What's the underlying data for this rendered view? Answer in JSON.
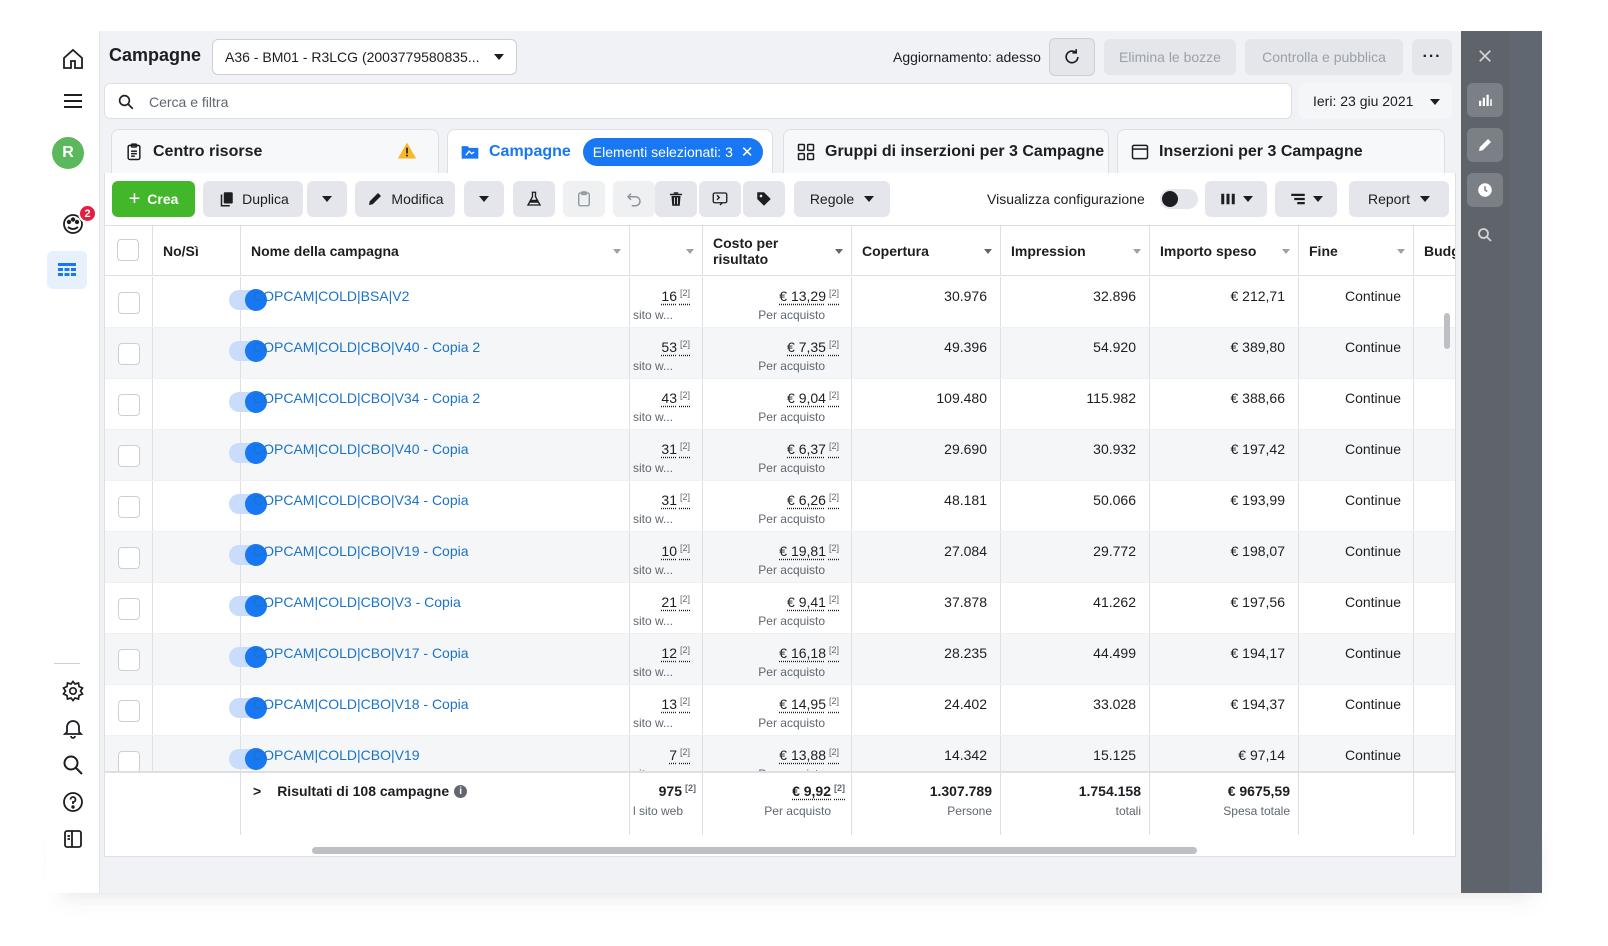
{
  "page": {
    "title": "Campagne"
  },
  "account": {
    "label": "A36 - BM01 - R3LCG (2003779580835..."
  },
  "header": {
    "update_status": "Aggiornamento: adesso",
    "discard_label": "Elimina le bozze",
    "publish_label": "Controlla e pubblica",
    "more_label": "···"
  },
  "search": {
    "placeholder": "Cerca e filtra"
  },
  "date_range": {
    "label": "Ieri: 23 giu 2021"
  },
  "rail": {
    "avatar_initial": "R",
    "notification_count": "2"
  },
  "tabs": {
    "resource_center": "Centro risorse",
    "campaigns": "Campagne",
    "selected_pill": "Elementi selezionati: 3",
    "adsets": "Gruppi di inserzioni per 3 Campagne",
    "ads": "Inserzioni per 3 Campagne"
  },
  "toolbar": {
    "create": "Crea",
    "duplicate": "Duplica",
    "edit": "Modifica",
    "rules": "Regole",
    "view_setup": "Visualizza configurazione",
    "report": "Report"
  },
  "table": {
    "headers": {
      "toggle": "No/Sì",
      "name": "Nome della campagna",
      "cost": "Costo per risultato",
      "reach": "Copertura",
      "impressions": "Impression",
      "spent": "Importo speso",
      "end": "Fine",
      "budget": "Budg"
    },
    "result_sub": "sito w...",
    "cost_sub": "Per acquisto",
    "sup": "[2]",
    "rows": [
      {
        "name": "COPCAM|COLD|BSA|V2",
        "results": "16",
        "cost": "€ 13,29",
        "reach": "30.976",
        "impressions": "32.896",
        "spent": "€ 212,71",
        "end": "Continue"
      },
      {
        "name": "COPCAM|COLD|CBO|V40 - Copia 2",
        "results": "53",
        "cost": "€ 7,35",
        "reach": "49.396",
        "impressions": "54.920",
        "spent": "€ 389,80",
        "end": "Continue"
      },
      {
        "name": "COPCAM|COLD|CBO|V34 - Copia 2",
        "results": "43",
        "cost": "€ 9,04",
        "reach": "109.480",
        "impressions": "115.982",
        "spent": "€ 388,66",
        "end": "Continue"
      },
      {
        "name": "COPCAM|COLD|CBO|V40 - Copia",
        "results": "31",
        "cost": "€ 6,37",
        "reach": "29.690",
        "impressions": "30.932",
        "spent": "€ 197,42",
        "end": "Continue"
      },
      {
        "name": "COPCAM|COLD|CBO|V34 - Copia",
        "results": "31",
        "cost": "€ 6,26",
        "reach": "48.181",
        "impressions": "50.066",
        "spent": "€ 193,99",
        "end": "Continue"
      },
      {
        "name": "COPCAM|COLD|CBO|V19 - Copia",
        "results": "10",
        "cost": "€ 19,81",
        "reach": "27.084",
        "impressions": "29.772",
        "spent": "€ 198,07",
        "end": "Continue"
      },
      {
        "name": "COPCAM|COLD|CBO|V3 - Copia",
        "results": "21",
        "cost": "€ 9,41",
        "reach": "37.878",
        "impressions": "41.262",
        "spent": "€ 197,56",
        "end": "Continue"
      },
      {
        "name": "COPCAM|COLD|CBO|V17 - Copia",
        "results": "12",
        "cost": "€ 16,18",
        "reach": "28.235",
        "impressions": "44.499",
        "spent": "€ 194,17",
        "end": "Continue"
      },
      {
        "name": "COPCAM|COLD|CBO|V18 - Copia",
        "results": "13",
        "cost": "€ 14,95",
        "reach": "24.402",
        "impressions": "33.028",
        "spent": "€ 194,37",
        "end": "Continue"
      },
      {
        "name": "COPCAM|COLD|CBO|V19",
        "results": "7",
        "cost": "€ 13,88",
        "reach": "14.342",
        "impressions": "15.125",
        "spent": "€ 97,14",
        "end": "Continue"
      }
    ],
    "totals": {
      "label": "Risultati di 108 campagne",
      "results": "975",
      "results_sub": "l sito web",
      "cost": "€ 9,92",
      "cost_sub": "Per acquisto",
      "reach": "1.307.789",
      "reach_sub": "Persone",
      "impressions": "1.754.158",
      "impressions_sub": "totali",
      "spent": "€ 9675,59",
      "spent_sub": "Spesa totale"
    }
  },
  "colors": {
    "primary": "#1877f2",
    "create": "#42b72a",
    "link": "#1a73c8",
    "warning": "#f7b928",
    "badge": "#e41e3f"
  }
}
